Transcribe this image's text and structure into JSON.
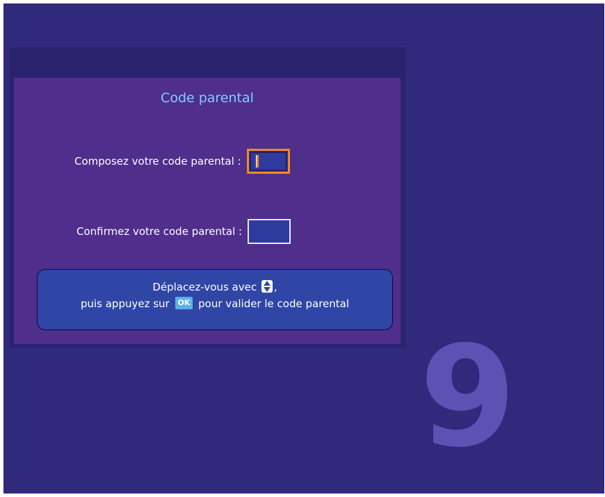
{
  "dialog": {
    "title": "Code parental",
    "fields": [
      {
        "label": "Composez votre code parental :",
        "value": ""
      },
      {
        "label": "Confirmez votre code parental :",
        "value": ""
      }
    ]
  },
  "help": {
    "line1_text": "Déplacez-vous avec",
    "line1_suffix": ",",
    "line2_prefix": "puis appuyez sur",
    "ok_key": "OK",
    "line2_suffix": "pour valider le code parental"
  },
  "logo": {
    "text": "9"
  },
  "colors": {
    "background": "#2f2a7c",
    "dialog": "#4f2e8c",
    "title": "#7fd0ff",
    "focus": "#f08a1e",
    "help_box": "#2f46a6"
  },
  "icons": {
    "navigate": "up-down-arrows-icon"
  }
}
